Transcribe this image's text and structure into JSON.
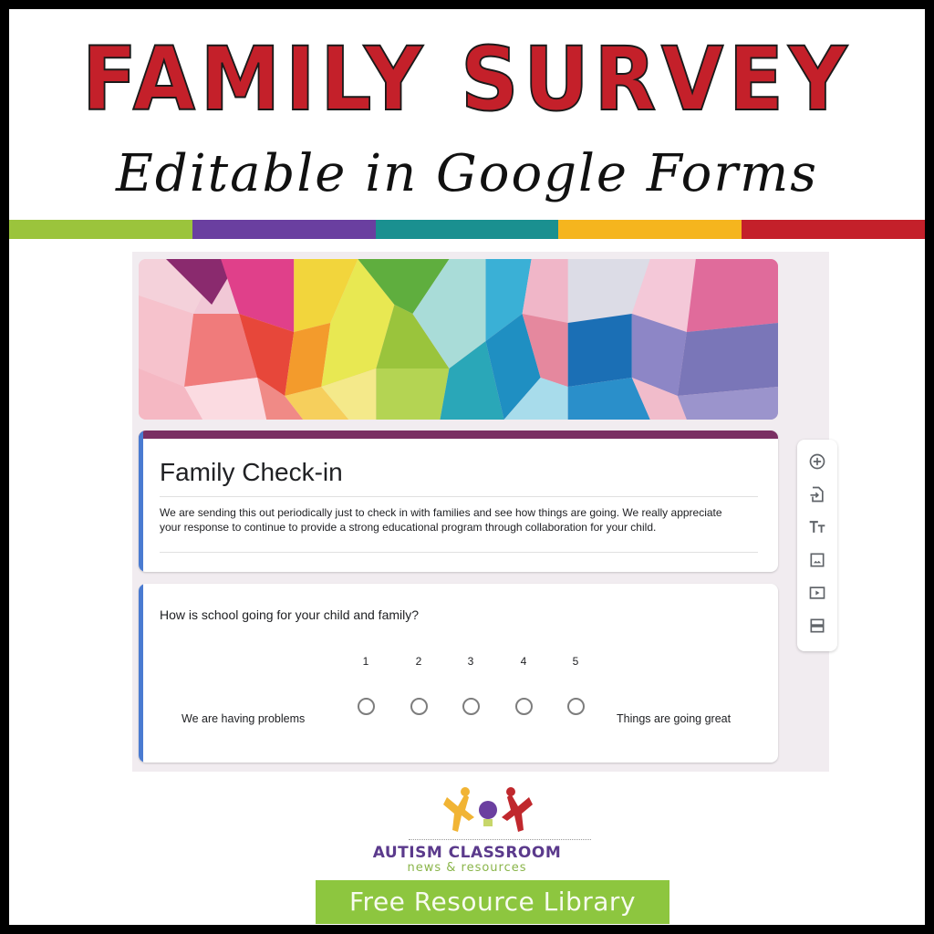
{
  "header": {
    "title": "FAMILY SURVEY",
    "subtitle": "Editable in Google Forms",
    "stripe_colors": [
      "#9bc43c",
      "#6a3fa0",
      "#1a9090",
      "#f5b51e",
      "#c4202a"
    ]
  },
  "form": {
    "theme_color": "#7a2f63",
    "accent_color": "#4a7bd1",
    "title": "Family Check-in",
    "description": "We are sending this out periodically just to check in with families and see how things are going. We really appreciate your response to continue to provide a strong educational program through collaboration for your child.",
    "question": {
      "text": "How is school going for your child and family?",
      "scale": [
        "1",
        "2",
        "3",
        "4",
        "5"
      ],
      "low_label": "We are having problems",
      "high_label": "Things are going great"
    },
    "toolbar": [
      {
        "name": "add-question",
        "icon": "plus-circle-icon"
      },
      {
        "name": "import-questions",
        "icon": "import-icon"
      },
      {
        "name": "add-title",
        "icon": "text-size-icon"
      },
      {
        "name": "add-image",
        "icon": "image-icon"
      },
      {
        "name": "add-video",
        "icon": "video-icon"
      },
      {
        "name": "add-section",
        "icon": "section-icon"
      }
    ]
  },
  "footer": {
    "brand": "AUTISM CLASSROOM",
    "brand_sub": "news & resources",
    "button": "Free Resource Library"
  }
}
